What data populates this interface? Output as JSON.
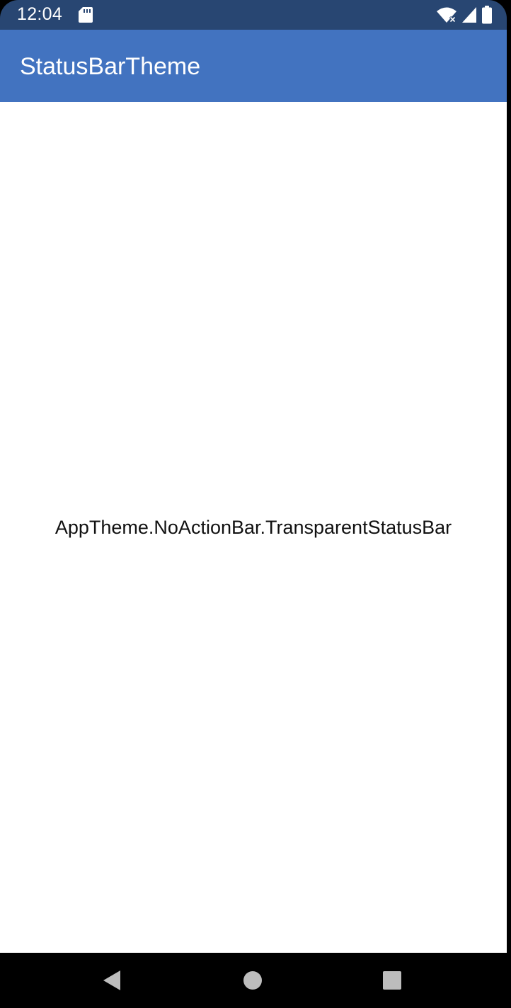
{
  "status_bar": {
    "time": "12:04",
    "icons": [
      "sd-card-icon",
      "wifi-icon",
      "cell-signal-icon",
      "battery-icon"
    ]
  },
  "app_bar": {
    "title": "StatusBarTheme"
  },
  "content": {
    "theme_label": "AppTheme.NoActionBar.TransparentStatusBar"
  },
  "nav_bar": {
    "buttons": [
      "back-icon",
      "home-icon",
      "recents-icon"
    ]
  },
  "colors": {
    "status_bar": "#284672",
    "app_bar": "#4273c0",
    "content_bg": "#ffffff",
    "nav_bar": "#000000",
    "nav_icon": "#bdbdbd"
  }
}
